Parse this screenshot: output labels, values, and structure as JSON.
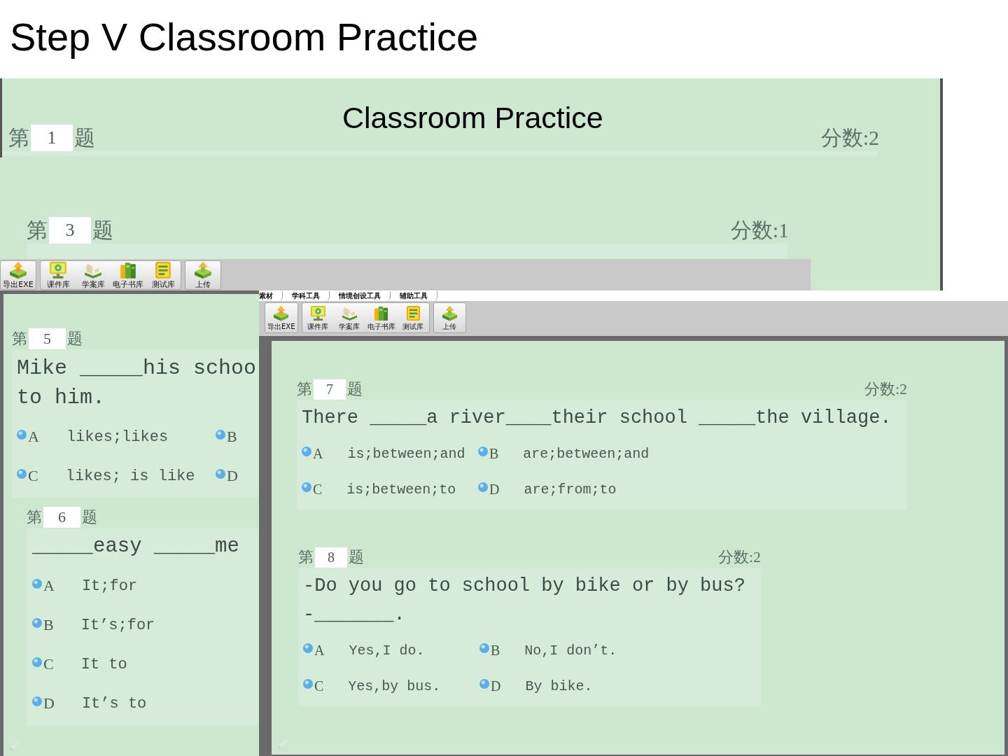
{
  "slide_title": "Step V Classroom Practice",
  "back_window": {
    "heading": "Classroom Practice",
    "questions": [
      {
        "prefix": "第",
        "number": "1",
        "suffix": "题",
        "score": "分数:2"
      },
      {
        "prefix": "第",
        "number": "3",
        "suffix": "题",
        "score": "分数:1"
      }
    ]
  },
  "left_window": {
    "toolbar": [
      [
        {
          "label": "导出EXE"
        }
      ],
      [
        {
          "label": "课件库"
        },
        {
          "label": "学案库"
        },
        {
          "label": "电子书库"
        },
        {
          "label": "测试库"
        }
      ],
      [
        {
          "label": "上传"
        }
      ]
    ],
    "questions": [
      {
        "kind": "paired",
        "prefix": "第",
        "number": "5",
        "suffix": "题",
        "stem": [
          "Mike _____his schoo",
          "to him."
        ],
        "options": [
          {
            "letter": "A",
            "text": "likes;likes"
          },
          {
            "letter": "B"
          },
          {
            "letter": "C",
            "text": "likes; is like"
          },
          {
            "letter": "D"
          }
        ]
      },
      {
        "kind": "stacked",
        "prefix": "第",
        "number": "6",
        "suffix": "题",
        "stem": [
          "_____easy _____me"
        ],
        "options": [
          {
            "letter": "A",
            "text": "It;for"
          },
          {
            "letter": "B",
            "text": "It’s;for"
          },
          {
            "letter": "C",
            "text": "It to"
          },
          {
            "letter": "D",
            "text": "It’s to"
          }
        ]
      }
    ]
  },
  "right_window": {
    "tabs": [
      {
        "label": "素材"
      },
      {
        "label": "学科工具"
      },
      {
        "label": "情境创设工具"
      },
      {
        "label": "辅助工具"
      }
    ],
    "toolbar": [
      [
        {
          "label": "导出EXE"
        }
      ],
      [
        {
          "label": "课件库"
        },
        {
          "label": "学案库"
        },
        {
          "label": "电子书库"
        },
        {
          "label": "测试库"
        }
      ],
      [
        {
          "label": "上传"
        }
      ]
    ],
    "questions": [
      {
        "kind": "paired",
        "prefix": "第",
        "number": "7",
        "suffix": "题",
        "score": "分数:2",
        "stem": [
          "There _____a river____their school _____the village."
        ],
        "options": [
          {
            "letter": "A",
            "text": "is;between;and"
          },
          {
            "letter": "B",
            "text": "are;between;and"
          },
          {
            "letter": "C",
            "text": "is;between;to"
          },
          {
            "letter": "D",
            "text": "are;from;to"
          }
        ]
      },
      {
        "kind": "paired",
        "prefix": "第",
        "number": "8",
        "suffix": "题",
        "score": "分数:2",
        "stem": [
          "-Do you go to school by bike or by bus?",
          "-_______."
        ],
        "options": [
          {
            "letter": "A",
            "text": "Yes,I do."
          },
          {
            "letter": "B",
            "text": "No,I don’t."
          },
          {
            "letter": "C",
            "text": "Yes,by bus."
          },
          {
            "letter": "D",
            "text": "By bike."
          }
        ]
      }
    ]
  }
}
